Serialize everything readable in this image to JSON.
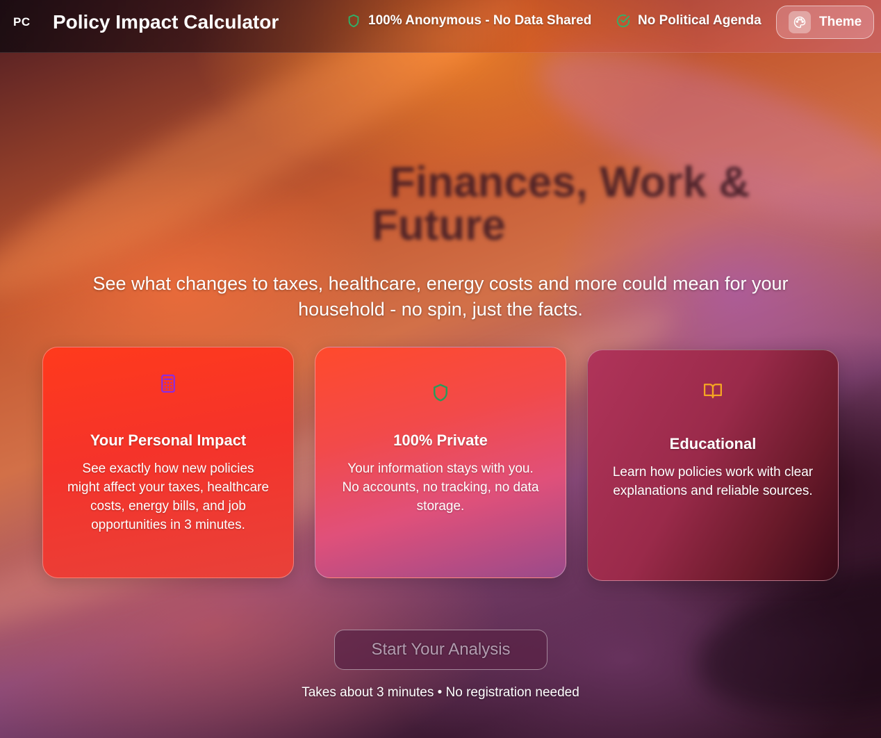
{
  "header": {
    "logo": "PC",
    "title": "Policy Impact Calculator",
    "badges": [
      {
        "label": "100% Anonymous - No Data Shared",
        "icon": "shield-icon",
        "color": "#2db36a"
      },
      {
        "label": "No Political Agenda",
        "icon": "check-circle-icon",
        "color": "#2db36a"
      }
    ],
    "theme_button": {
      "label": "Theme",
      "icon": "palette-icon"
    }
  },
  "hero": {
    "title": "Finances, Work & Future",
    "subtitle": "See what changes to taxes, healthcare, energy costs and more could mean for your household - no spin, just the facts."
  },
  "cards": [
    {
      "icon": "calculator-icon",
      "icon_color": "#8a2be2",
      "title": "Your Personal Impact",
      "description": "See exactly how new policies might affect your taxes, healthcare costs, energy bills, and job opportunities in 3 minutes."
    },
    {
      "icon": "shield-icon",
      "icon_color": "#2a9a5a",
      "title": "100% Private",
      "description": "Your information stays with you. No accounts, no tracking, no data storage."
    },
    {
      "icon": "book-open-icon",
      "icon_color": "#f5a623",
      "title": "Educational",
      "description": "Learn how policies work with clear explanations and reliable sources."
    }
  ],
  "cta": {
    "button_label": "Start Your Analysis",
    "note": "Takes about 3 minutes • No registration needed"
  }
}
